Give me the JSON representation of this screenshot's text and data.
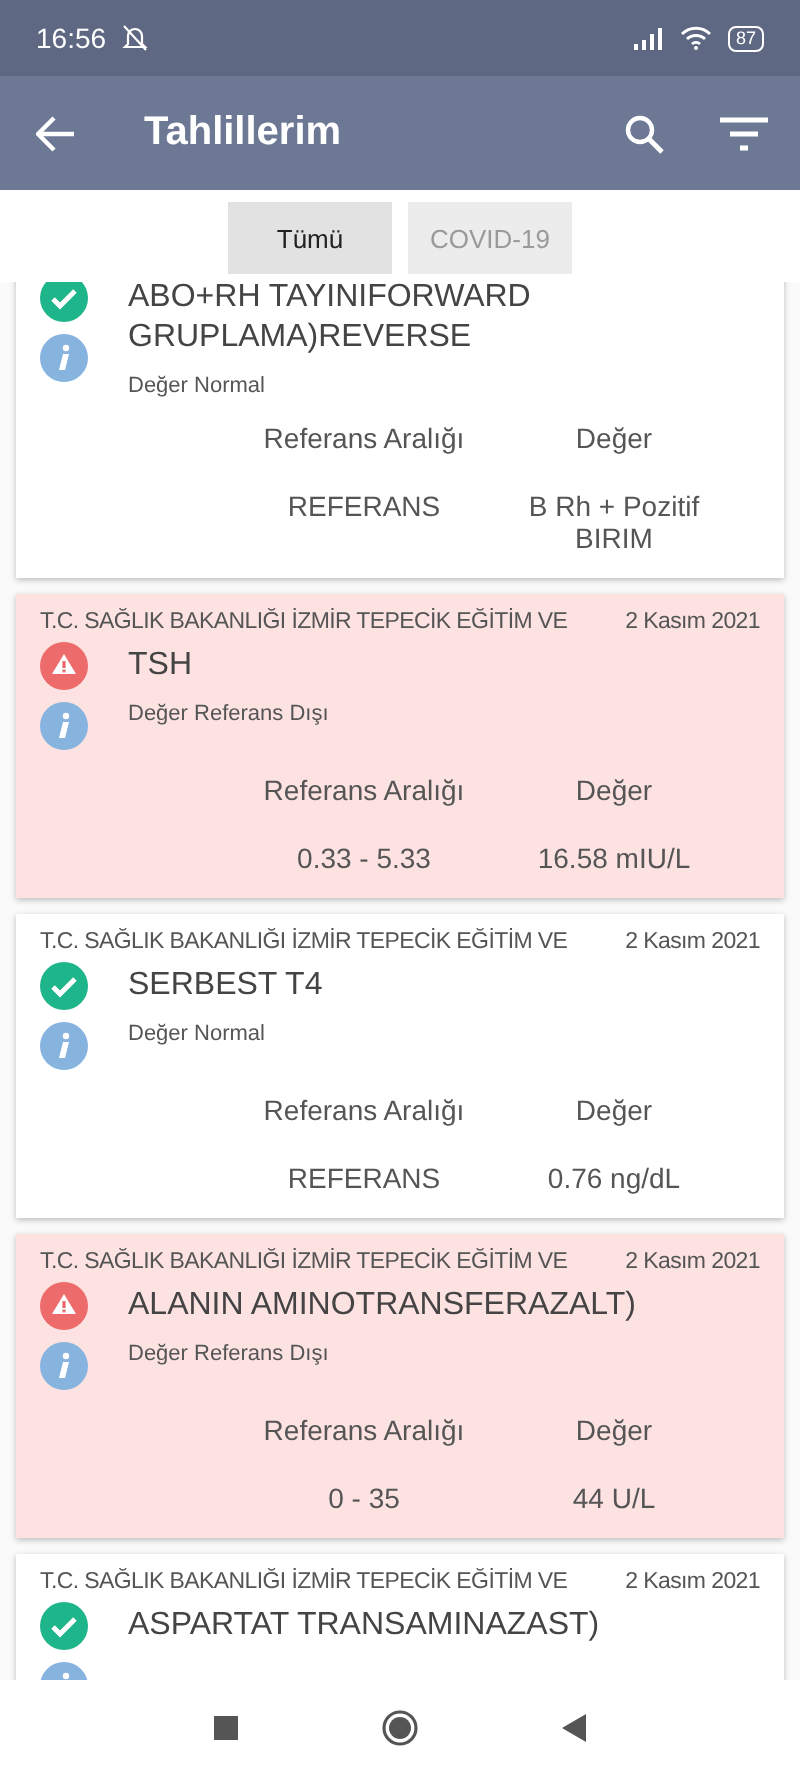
{
  "status_bar": {
    "time": "16:56",
    "battery": "87"
  },
  "app_bar": {
    "title": "Tahlillerim"
  },
  "tabs": [
    {
      "label": "Tümü",
      "selected": true
    },
    {
      "label": "COVID-19",
      "selected": false
    }
  ],
  "results": [
    {
      "abnormal": false,
      "title": "ABO+RH TAYINIFORWARD GRUPLAMA)REVERSE",
      "status": "Değer Normal",
      "range_label": "Referans Aralığı",
      "value_label": "Değer",
      "range": "REFERANS",
      "value": "B Rh + Pozitif BIRIM"
    },
    {
      "abnormal": true,
      "institution": "T.C. SAĞLIK BAKANLIĞI İZMİR TEPECİK EĞİTİM VE",
      "date": "2 Kasım 2021",
      "title": "TSH",
      "status": "Değer Referans Dışı",
      "range_label": "Referans Aralığı",
      "value_label": "Değer",
      "range": "0.33 - 5.33",
      "value": "16.58 mIU/L"
    },
    {
      "abnormal": false,
      "institution": "T.C. SAĞLIK BAKANLIĞI İZMİR TEPECİK EĞİTİM VE",
      "date": "2 Kasım 2021",
      "title": "SERBEST T4",
      "status": "Değer Normal",
      "range_label": "Referans Aralığı",
      "value_label": "Değer",
      "range": "REFERANS",
      "value": "0.76 ng/dL"
    },
    {
      "abnormal": true,
      "institution": "T.C. SAĞLIK BAKANLIĞI İZMİR TEPECİK EĞİTİM VE",
      "date": "2 Kasım 2021",
      "title": "ALANIN AMINOTRANSFERAZALT)",
      "status": "Değer Referans Dışı",
      "range_label": "Referans Aralığı",
      "value_label": "Değer",
      "range": "0 - 35",
      "value": "44 U/L"
    },
    {
      "abnormal": false,
      "institution": "T.C. SAĞLIK BAKANLIĞI İZMİR TEPECİK EĞİTİM VE",
      "date": "2 Kasım 2021",
      "title": "ASPARTAT TRANSAMINAZAST)"
    }
  ]
}
